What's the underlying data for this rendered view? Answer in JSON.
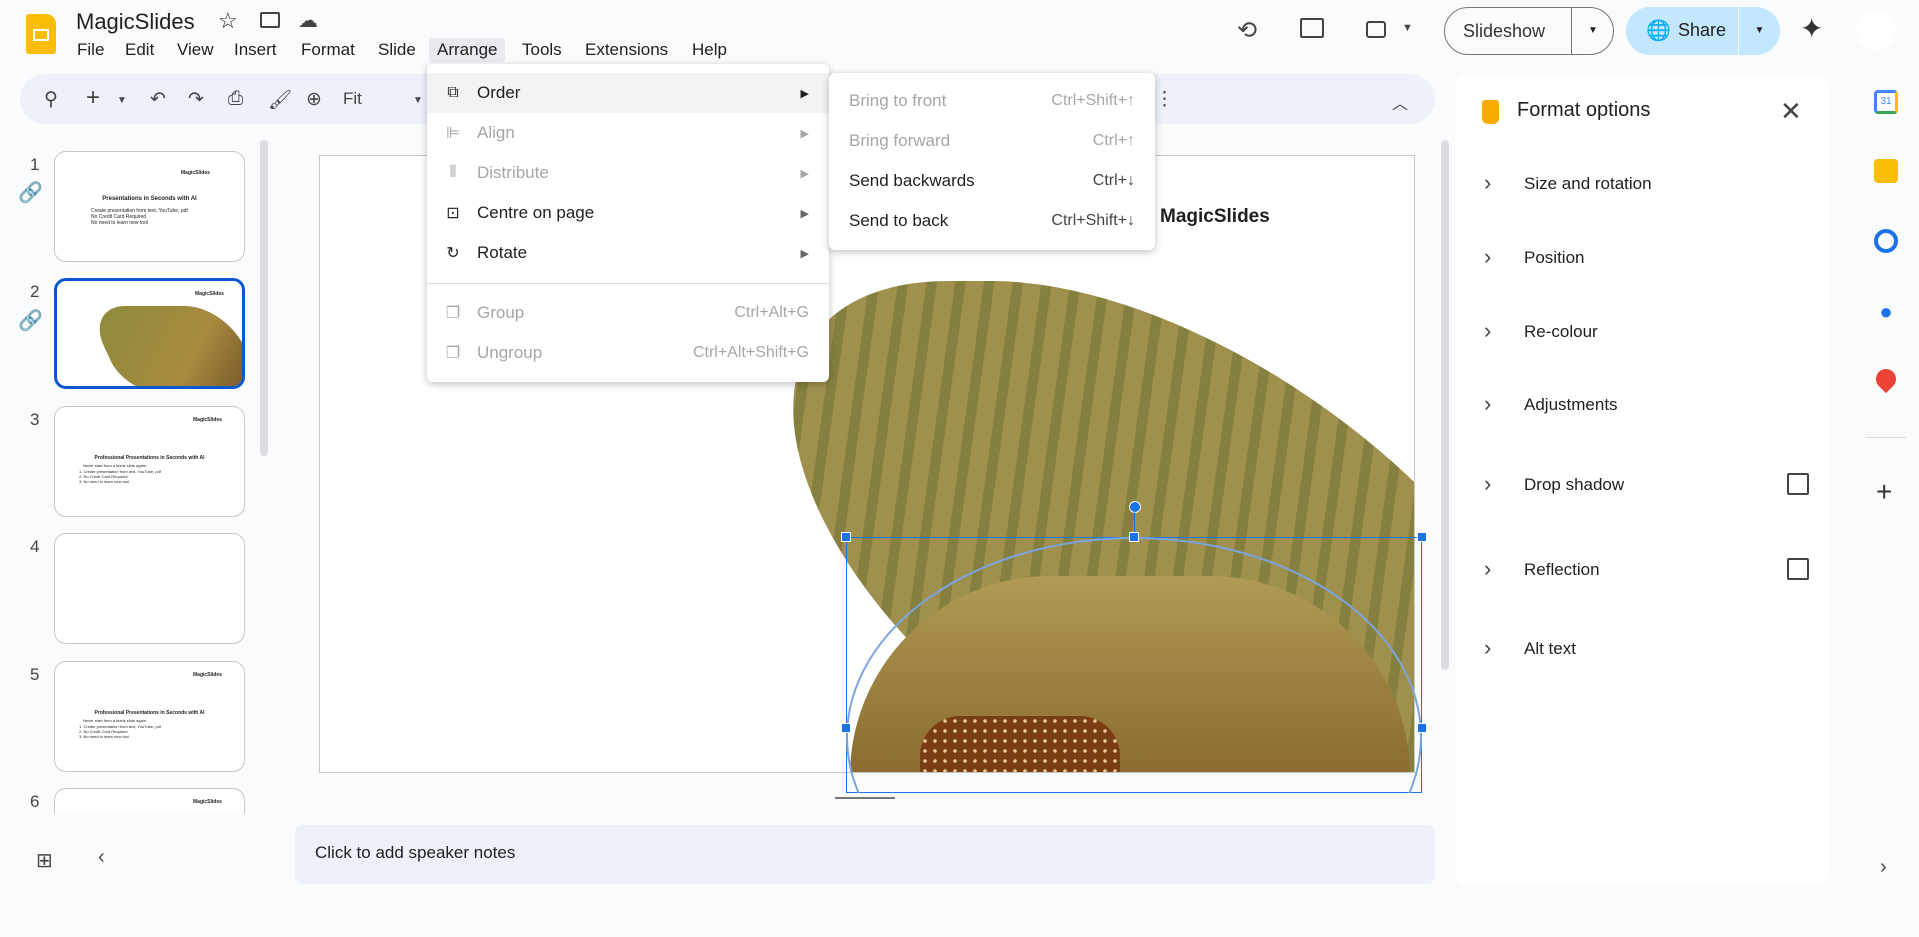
{
  "app": {
    "title": "MagicSlides",
    "menus": [
      "File",
      "Edit",
      "View",
      "Insert",
      "Format",
      "Slide",
      "Arrange",
      "Tools",
      "Extensions",
      "Help"
    ]
  },
  "header": {
    "slideshow_label": "Slideshow",
    "share_label": "Share"
  },
  "toolbar": {
    "zoom_value": "Fit"
  },
  "arrange_menu": {
    "items": [
      {
        "label": "Order",
        "icon": "order-icon",
        "enabled": true
      },
      {
        "label": "Align",
        "icon": "align-icon",
        "enabled": false
      },
      {
        "label": "Distribute",
        "icon": "distribute-icon",
        "enabled": false
      },
      {
        "label": "Centre on page",
        "icon": "centre-icon",
        "enabled": true
      },
      {
        "label": "Rotate",
        "icon": "rotate-icon",
        "enabled": true
      },
      {
        "label": "Group",
        "shortcut": "Ctrl+Alt+G",
        "enabled": false
      },
      {
        "label": "Ungroup",
        "shortcut": "Ctrl+Alt+Shift+G",
        "enabled": false
      }
    ]
  },
  "order_submenu": {
    "items": [
      {
        "label": "Bring to front",
        "shortcut": "Ctrl+Shift+↑",
        "enabled": false
      },
      {
        "label": "Bring forward",
        "shortcut": "Ctrl+↑",
        "enabled": false
      },
      {
        "label": "Send backwards",
        "shortcut": "Ctrl+↓",
        "enabled": true
      },
      {
        "label": "Send to back",
        "shortcut": "Ctrl+Shift+↓",
        "enabled": true
      }
    ]
  },
  "filmstrip": {
    "slides": [
      {
        "number": "1",
        "logo": "MagicSlides",
        "title": "Presentations in Seconds with AI",
        "bullets": [
          "Create presentation from text, YouTube, pdf",
          "No Credit Card Required",
          "No need to learn new tool"
        ]
      },
      {
        "number": "2",
        "logo": "MagicSlides"
      },
      {
        "number": "3",
        "logo": "MagicSlides",
        "title": "Professional Presentations in Seconds with AI",
        "subtitle": "Never start from a blank slide again.",
        "bullets": [
          "1. Create presentation from text, YouTube, pdf",
          "2. No Credit Card Required",
          "3. No need to learn new tool"
        ]
      },
      {
        "number": "4"
      },
      {
        "number": "5",
        "logo": "MagicSlides",
        "title": "Professional Presentations in Seconds with AI",
        "subtitle": "Never start from a blank slide again.",
        "bullets": [
          "1. Create presentation from text, YouTube, pdf",
          "2. No Credit Card Required",
          "3. No need to learn new tool"
        ]
      },
      {
        "number": "6",
        "logo": "MagicSlides"
      }
    ]
  },
  "canvas": {
    "logo_text": "MagicSlides"
  },
  "speaker_notes": {
    "placeholder": "Click to add speaker notes"
  },
  "format_panel": {
    "title": "Format options",
    "sections": [
      "Size and rotation",
      "Position",
      "Re-colour",
      "Adjustments",
      "Drop shadow",
      "Reflection",
      "Alt text"
    ]
  },
  "colors": {
    "accent": "#1a73e8",
    "share_bg": "#c2e7ff",
    "menu_hover": "#f1f3f4"
  }
}
